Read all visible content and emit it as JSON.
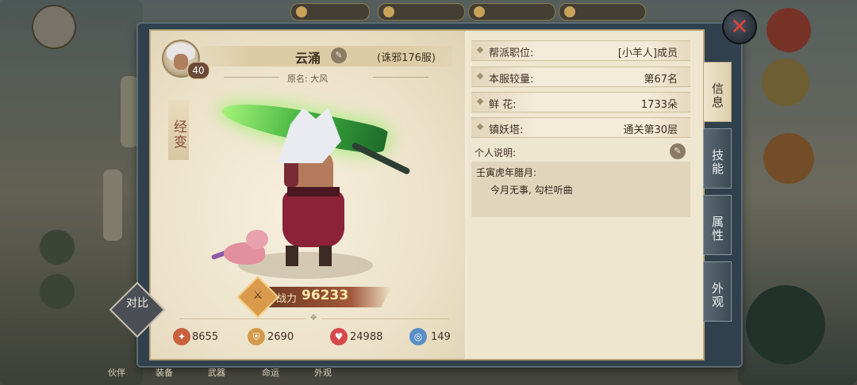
{
  "player": {
    "level": "40",
    "name": "云涌",
    "server": "(诛邪176服)",
    "original_name": "原名: 大风",
    "side_label": "经变"
  },
  "combat": {
    "label": "战力",
    "value": "96233"
  },
  "stats": [
    {
      "icon": "attack-icon",
      "value": "8655",
      "color": "#c9603e"
    },
    {
      "icon": "defense-icon",
      "value": "2690",
      "color": "#d39a4c"
    },
    {
      "icon": "health-icon",
      "value": "24988",
      "color": "#d6484a"
    },
    {
      "icon": "speed-icon",
      "value": "149",
      "color": "#5a8fc8"
    }
  ],
  "compare_button": {
    "label": "对比"
  },
  "info": [
    {
      "label": "帮派职位:",
      "value": "[小羊人]成员"
    },
    {
      "label": "本服较量:",
      "value": "第67名"
    },
    {
      "label": "鲜  花:",
      "value": "1733朵"
    },
    {
      "label": "镇妖塔:",
      "value": "通关第30层"
    }
  ],
  "bio": {
    "title": "个人说明:",
    "line1": "壬寅虎年腊月:",
    "line2": "今月无事, 勾栏听曲"
  },
  "tabs": [
    {
      "label": "信息",
      "active": true
    },
    {
      "label": "技能",
      "active": false
    },
    {
      "label": "属性",
      "active": false
    },
    {
      "label": "外观",
      "active": false
    }
  ],
  "close_button": {
    "glyph": "✕"
  },
  "bottom_nav": [
    "伙伴",
    "装备",
    "武器",
    "命运",
    "外观"
  ]
}
